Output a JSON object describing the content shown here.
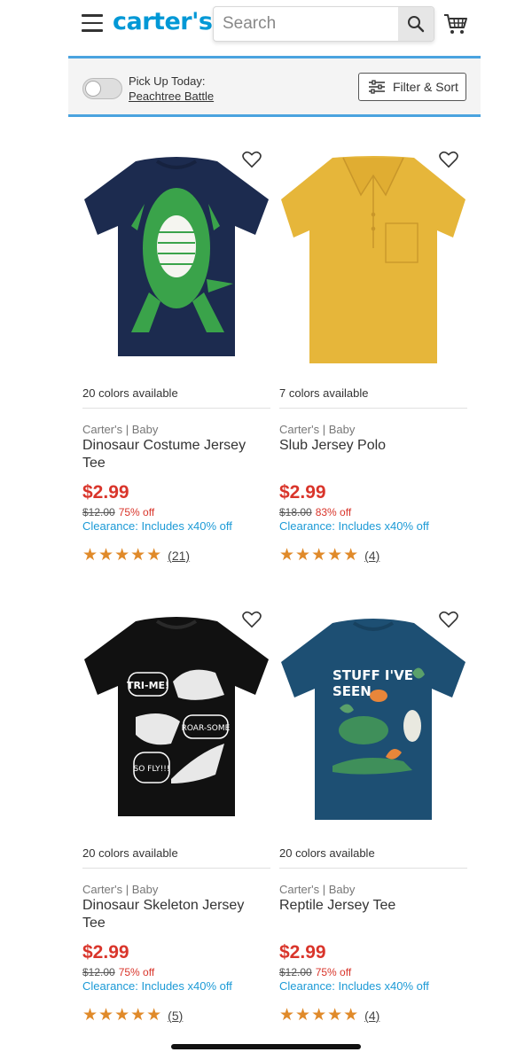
{
  "header": {
    "logo": "carter's",
    "search_placeholder": "Search"
  },
  "filter_bar": {
    "pickup_label": "Pick Up Today:",
    "pickup_store": "Peachtree Battle",
    "filter_label": "Filter & Sort"
  },
  "products": [
    {
      "colors": "20 colors available",
      "brand": "Carter's | Baby",
      "name": "Dinosaur Costume Jersey Tee",
      "price": "$2.99",
      "original": "$12.00",
      "discount": "75% off",
      "clearance": "Clearance: Includes x40% off",
      "stars": "★★★★★",
      "reviews": "(21)"
    },
    {
      "colors": "7 colors available",
      "brand": "Carter's | Baby",
      "name": "Slub Jersey Polo",
      "price": "$2.99",
      "original": "$18.00",
      "discount": "83% off",
      "clearance": "Clearance: Includes x40% off",
      "stars": "★★★★★",
      "reviews": "(4)"
    },
    {
      "colors": "20 colors available",
      "brand": "Carter's | Baby",
      "name": "Dinosaur Skeleton Jersey Tee",
      "price": "$2.99",
      "original": "$12.00",
      "discount": "75% off",
      "clearance": "Clearance: Includes x40% off",
      "stars": "★★★★★",
      "reviews": "(5)"
    },
    {
      "colors": "20 colors available",
      "brand": "Carter's | Baby",
      "name": "Reptile Jersey Tee",
      "price": "$2.99",
      "original": "$12.00",
      "discount": "75% off",
      "clearance": "Clearance: Includes x40% off",
      "stars": "★★★★★",
      "reviews": "(4)"
    }
  ],
  "graphics": {
    "shirt1_text": "",
    "shirt3_text_1": "TRI-ME!",
    "shirt3_text_2": "ROAR-SOME",
    "shirt3_text_3": "SO FLY!!!",
    "shirt4_text_1": "STUFF I'VE",
    "shirt4_text_2": "SEEN"
  },
  "colors": {
    "brand_blue": "#0098d6",
    "price_red": "#d9352b",
    "clearance_blue": "#1c9ad6",
    "star_orange": "#e08a2a",
    "divider_blue": "#4aa3df"
  }
}
